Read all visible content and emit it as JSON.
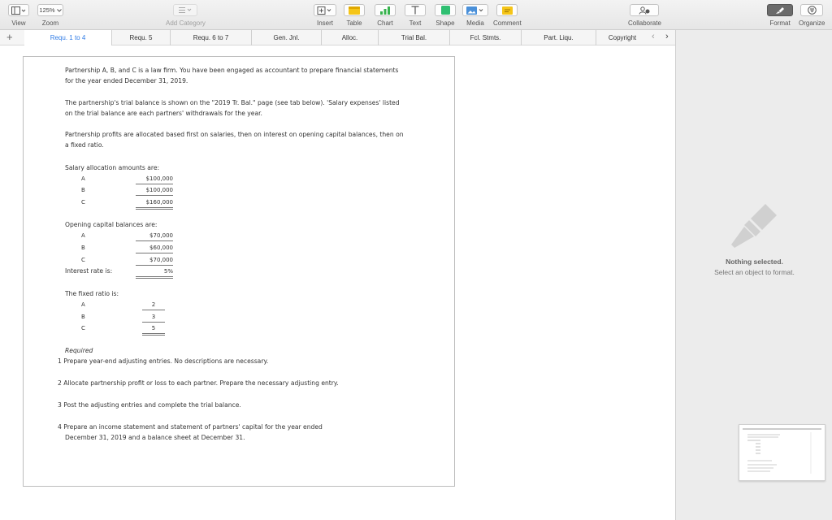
{
  "toolbar": {
    "view_label": "View",
    "zoom_value": "125%",
    "zoom_label": "Zoom",
    "add_category_label": "Add Category",
    "insert_label": "Insert",
    "table_label": "Table",
    "chart_label": "Chart",
    "text_label": "Text",
    "shape_label": "Shape",
    "media_label": "Media",
    "comment_label": "Comment",
    "collaborate_label": "Collaborate",
    "format_label": "Format",
    "organize_label": "Organize",
    "accent": "#2f7be6"
  },
  "tabs": [
    {
      "label": "Requ. 1 to 4",
      "active": true
    },
    {
      "label": "Requ. 5",
      "active": false
    },
    {
      "label": "Requ. 6 to 7",
      "active": false
    },
    {
      "label": "Gen. Jnl.",
      "active": false
    },
    {
      "label": "Alloc.",
      "active": false
    },
    {
      "label": "Trial Bal.",
      "active": false
    },
    {
      "label": "Fcl. Stmts.",
      "active": false
    },
    {
      "label": "Part. Liqu.",
      "active": false
    },
    {
      "label": "Copyright",
      "active": false
    }
  ],
  "document": {
    "intro": "Partnership A, B, and C is a law firm. You have been engaged as accountant to prepare financial statements for the year ended December 31, 2019.",
    "trial_balance": "The partnership's trial balance is shown on the \"2019 Tr. Bal.\" page (see tab below). 'Salary expenses' listed on the trial balance are each partners' withdrawals for the year.",
    "profits": "Partnership profits are allocated based first on salaries, then on interest on opening capital balances, then on a fixed ratio.",
    "salary_heading": "Salary allocation amounts are:",
    "salaries": [
      {
        "partner": "A",
        "amount": "$100,000"
      },
      {
        "partner": "B",
        "amount": "$100,000"
      },
      {
        "partner": "C",
        "amount": "$160,000"
      }
    ],
    "capital_heading": "Opening capital balances are:",
    "capitals": [
      {
        "partner": "A",
        "amount": "$70,000"
      },
      {
        "partner": "B",
        "amount": "$60,000"
      },
      {
        "partner": "C",
        "amount": "$70,000"
      }
    ],
    "interest_label": "Interest rate is:",
    "interest_value": "5%",
    "ratio_heading": "The fixed ratio is:",
    "ratios": [
      {
        "partner": "A",
        "value": "2"
      },
      {
        "partner": "B",
        "value": "3"
      },
      {
        "partner": "C",
        "value": "5"
      }
    ],
    "required_heading": "Required",
    "requirements": [
      {
        "num": "1",
        "text": "Prepare year-end adjusting entries. No descriptions are necessary."
      },
      {
        "num": "2",
        "text": "Allocate partnership profit or loss to each partner. Prepare the necessary adjusting entry."
      },
      {
        "num": "3",
        "text": "Post the adjusting entries and complete the trial balance."
      },
      {
        "num": "4",
        "text": "Prepare an income statement and statement of partners' capital for the year ended"
      }
    ],
    "req4_line2": "December 31, 2019 and a balance sheet at December 31."
  },
  "sidebar": {
    "nothing_title": "Nothing selected.",
    "nothing_sub": "Select an object to format."
  }
}
